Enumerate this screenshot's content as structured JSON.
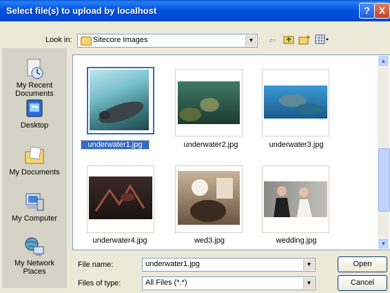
{
  "window": {
    "title": "Select file(s) to upload by localhost",
    "help_label": "?",
    "close_label": "X"
  },
  "lookin": {
    "label": "Look in:",
    "value": "Sitecore Images"
  },
  "toolbar": {
    "icons": [
      "back-arrow-icon",
      "up-folder-icon",
      "new-folder-icon",
      "views-menu-icon"
    ]
  },
  "places": [
    {
      "label": "My Recent Documents",
      "icon": "recent-documents-icon"
    },
    {
      "label": "Desktop",
      "icon": "desktop-icon"
    },
    {
      "label": "My Documents",
      "icon": "my-documents-icon"
    },
    {
      "label": "My Computer",
      "icon": "my-computer-icon"
    },
    {
      "label": "My Network Places",
      "icon": "network-places-icon"
    }
  ],
  "files": [
    {
      "name": "underwater1.jpg",
      "selected": true
    },
    {
      "name": "underwater2.jpg",
      "selected": false
    },
    {
      "name": "underwater3.jpg",
      "selected": false
    },
    {
      "name": "underwater4.jpg",
      "selected": false
    },
    {
      "name": "wed3.jpg",
      "selected": false
    },
    {
      "name": "wedding.jpg",
      "selected": false
    }
  ],
  "filename": {
    "label": "File name:",
    "value": "underwater1.jpg"
  },
  "filetype": {
    "label": "Files of type:",
    "value": "All Files (*.*)"
  },
  "buttons": {
    "open": "Open",
    "cancel": "Cancel"
  }
}
